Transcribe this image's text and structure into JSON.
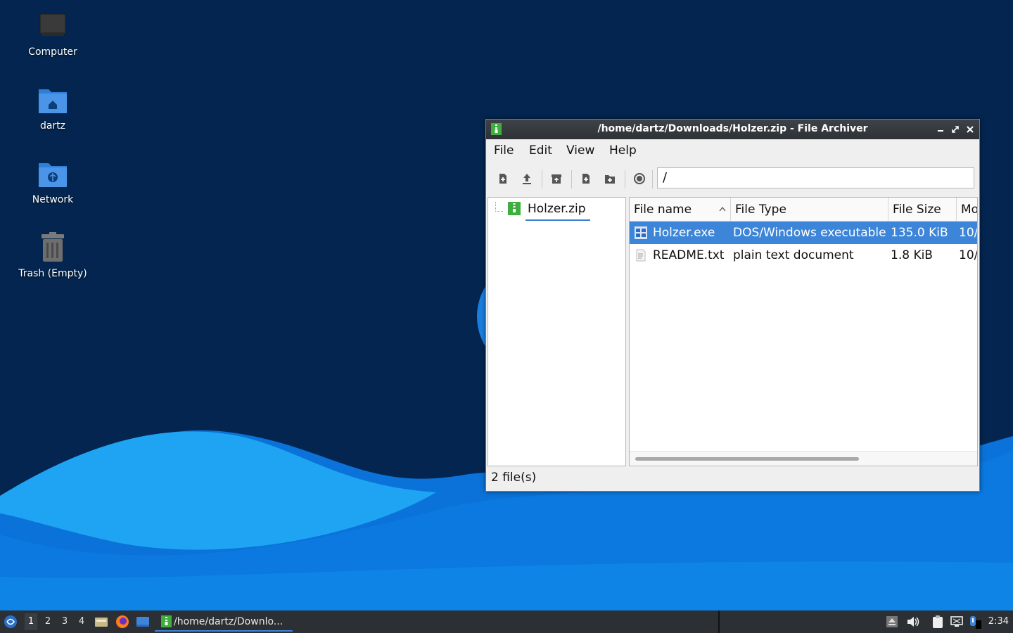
{
  "desktop": {
    "icons": [
      {
        "label": "Computer"
      },
      {
        "label": "dartz"
      },
      {
        "label": "Network"
      },
      {
        "label": "Trash (Empty)"
      }
    ]
  },
  "window": {
    "title": "/home/dartz/Downloads/Holzer.zip - File Archiver",
    "menu": [
      "File",
      "Edit",
      "View",
      "Help"
    ],
    "toolbar_icons": [
      "new-archive-icon",
      "open-archive-icon",
      "extract-icon",
      "add-files-icon",
      "add-folder-icon",
      "stop-icon"
    ],
    "location": "/",
    "tree": {
      "root": "Holzer.zip"
    },
    "columns": [
      "File name",
      "File Type",
      "File Size",
      "Mo"
    ],
    "files": [
      {
        "name": "Holzer.exe",
        "type": "DOS/Windows executable",
        "size": "135.0 KiB",
        "modified": "10/",
        "selected": true,
        "icon": "windows-exe-icon"
      },
      {
        "name": "README.txt",
        "type": "plain text document",
        "size": "1.8 KiB",
        "modified": "10/",
        "selected": false,
        "icon": "text-file-icon"
      }
    ],
    "status": "2 file(s)"
  },
  "taskbar": {
    "workspaces": [
      "1",
      "2",
      "3",
      "4"
    ],
    "active_workspace": "1",
    "task_label": "/home/dartz/Downlo...",
    "clock": "2:34"
  },
  "colors": {
    "desktop_bg": "#03254f",
    "wave_light": "#1595ea",
    "wave_dark": "#0a6fd6",
    "selection": "#3d85d8"
  }
}
